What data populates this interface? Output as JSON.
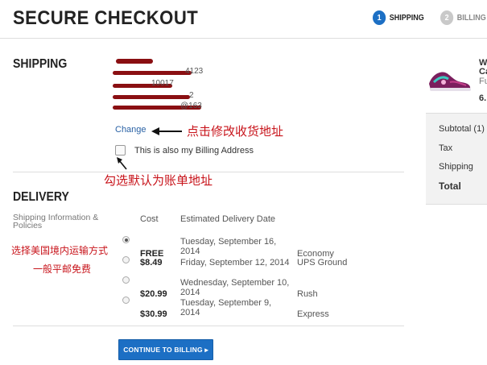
{
  "header": {
    "title": "SECURE CHECKOUT",
    "steps": [
      {
        "number": "1",
        "label": "SHIPPING",
        "active": true
      },
      {
        "number": "2",
        "label": "BILLING",
        "active": false
      }
    ],
    "colors": {
      "active_step": "#1c6fc4",
      "inactive_step": "#c9c9c9"
    }
  },
  "shipping": {
    "heading": "SHIPPING",
    "address_fragments": [
      "4123",
      "10017",
      "2",
      "@163"
    ],
    "change_link": "Change",
    "billing_checkbox_label": "This is also my Billing Address",
    "billing_checked": false,
    "annotation_change": "点击修改收货地址",
    "annotation_checkbox": "勾选默认为账单地址"
  },
  "delivery": {
    "heading": "DELIVERY",
    "info_label": "Shipping Information & Policies",
    "col_cost": "Cost",
    "col_date": "Estimated Delivery Date",
    "annotation_line1": "选择美国境内运输方式",
    "annotation_line2": "一般平邮免费",
    "options": [
      {
        "cost": "FREE",
        "date": "Tuesday, September 16, 2014",
        "method": "Economy",
        "selected": true
      },
      {
        "cost": "$8.49",
        "date": "Friday, September 12, 2014",
        "method": "UPS Ground",
        "selected": false
      },
      {
        "cost": "$20.99",
        "date": "Wednesday, September 10, 2014",
        "method": "Rush",
        "selected": false
      },
      {
        "cost": "$30.99",
        "date": "Tuesday, September 9, 2014",
        "method": "Express",
        "selected": false
      }
    ]
  },
  "continue_button": "CONTINUE TO BILLING ▸",
  "summary": {
    "product_title_fragment": "W",
    "product_line2": "Ca",
    "product_line3": "Fu",
    "product_price": "6.",
    "rows": [
      {
        "label": "Subtotal (1)",
        "bold": false
      },
      {
        "label": "Tax",
        "bold": false
      },
      {
        "label": "Shipping",
        "bold": false
      },
      {
        "label": "Total",
        "bold": true
      }
    ]
  }
}
